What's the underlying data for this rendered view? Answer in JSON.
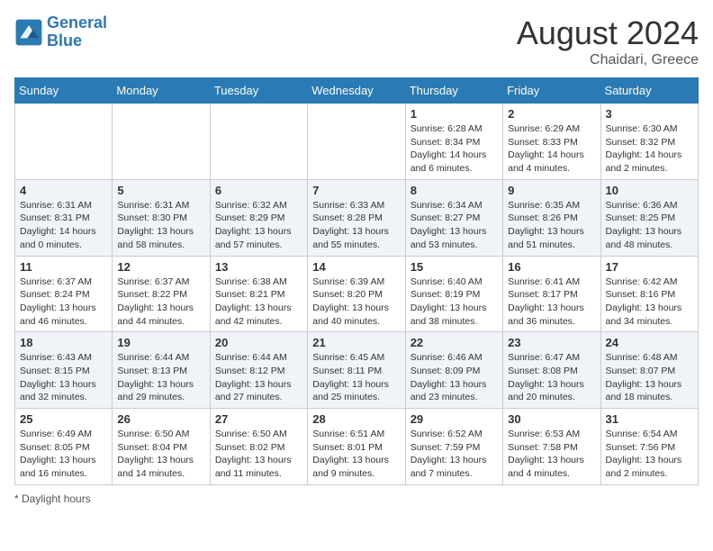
{
  "header": {
    "logo_general": "General",
    "logo_blue": "Blue",
    "month_year": "August 2024",
    "location": "Chaidari, Greece"
  },
  "days_of_week": [
    "Sunday",
    "Monday",
    "Tuesday",
    "Wednesday",
    "Thursday",
    "Friday",
    "Saturday"
  ],
  "weeks": [
    [
      {
        "day": "",
        "info": ""
      },
      {
        "day": "",
        "info": ""
      },
      {
        "day": "",
        "info": ""
      },
      {
        "day": "",
        "info": ""
      },
      {
        "day": "1",
        "info": "Sunrise: 6:28 AM\nSunset: 8:34 PM\nDaylight: 14 hours and 6 minutes."
      },
      {
        "day": "2",
        "info": "Sunrise: 6:29 AM\nSunset: 8:33 PM\nDaylight: 14 hours and 4 minutes."
      },
      {
        "day": "3",
        "info": "Sunrise: 6:30 AM\nSunset: 8:32 PM\nDaylight: 14 hours and 2 minutes."
      }
    ],
    [
      {
        "day": "4",
        "info": "Sunrise: 6:31 AM\nSunset: 8:31 PM\nDaylight: 14 hours and 0 minutes."
      },
      {
        "day": "5",
        "info": "Sunrise: 6:31 AM\nSunset: 8:30 PM\nDaylight: 13 hours and 58 minutes."
      },
      {
        "day": "6",
        "info": "Sunrise: 6:32 AM\nSunset: 8:29 PM\nDaylight: 13 hours and 57 minutes."
      },
      {
        "day": "7",
        "info": "Sunrise: 6:33 AM\nSunset: 8:28 PM\nDaylight: 13 hours and 55 minutes."
      },
      {
        "day": "8",
        "info": "Sunrise: 6:34 AM\nSunset: 8:27 PM\nDaylight: 13 hours and 53 minutes."
      },
      {
        "day": "9",
        "info": "Sunrise: 6:35 AM\nSunset: 8:26 PM\nDaylight: 13 hours and 51 minutes."
      },
      {
        "day": "10",
        "info": "Sunrise: 6:36 AM\nSunset: 8:25 PM\nDaylight: 13 hours and 48 minutes."
      }
    ],
    [
      {
        "day": "11",
        "info": "Sunrise: 6:37 AM\nSunset: 8:24 PM\nDaylight: 13 hours and 46 minutes."
      },
      {
        "day": "12",
        "info": "Sunrise: 6:37 AM\nSunset: 8:22 PM\nDaylight: 13 hours and 44 minutes."
      },
      {
        "day": "13",
        "info": "Sunrise: 6:38 AM\nSunset: 8:21 PM\nDaylight: 13 hours and 42 minutes."
      },
      {
        "day": "14",
        "info": "Sunrise: 6:39 AM\nSunset: 8:20 PM\nDaylight: 13 hours and 40 minutes."
      },
      {
        "day": "15",
        "info": "Sunrise: 6:40 AM\nSunset: 8:19 PM\nDaylight: 13 hours and 38 minutes."
      },
      {
        "day": "16",
        "info": "Sunrise: 6:41 AM\nSunset: 8:17 PM\nDaylight: 13 hours and 36 minutes."
      },
      {
        "day": "17",
        "info": "Sunrise: 6:42 AM\nSunset: 8:16 PM\nDaylight: 13 hours and 34 minutes."
      }
    ],
    [
      {
        "day": "18",
        "info": "Sunrise: 6:43 AM\nSunset: 8:15 PM\nDaylight: 13 hours and 32 minutes."
      },
      {
        "day": "19",
        "info": "Sunrise: 6:44 AM\nSunset: 8:13 PM\nDaylight: 13 hours and 29 minutes."
      },
      {
        "day": "20",
        "info": "Sunrise: 6:44 AM\nSunset: 8:12 PM\nDaylight: 13 hours and 27 minutes."
      },
      {
        "day": "21",
        "info": "Sunrise: 6:45 AM\nSunset: 8:11 PM\nDaylight: 13 hours and 25 minutes."
      },
      {
        "day": "22",
        "info": "Sunrise: 6:46 AM\nSunset: 8:09 PM\nDaylight: 13 hours and 23 minutes."
      },
      {
        "day": "23",
        "info": "Sunrise: 6:47 AM\nSunset: 8:08 PM\nDaylight: 13 hours and 20 minutes."
      },
      {
        "day": "24",
        "info": "Sunrise: 6:48 AM\nSunset: 8:07 PM\nDaylight: 13 hours and 18 minutes."
      }
    ],
    [
      {
        "day": "25",
        "info": "Sunrise: 6:49 AM\nSunset: 8:05 PM\nDaylight: 13 hours and 16 minutes."
      },
      {
        "day": "26",
        "info": "Sunrise: 6:50 AM\nSunset: 8:04 PM\nDaylight: 13 hours and 14 minutes."
      },
      {
        "day": "27",
        "info": "Sunrise: 6:50 AM\nSunset: 8:02 PM\nDaylight: 13 hours and 11 minutes."
      },
      {
        "day": "28",
        "info": "Sunrise: 6:51 AM\nSunset: 8:01 PM\nDaylight: 13 hours and 9 minutes."
      },
      {
        "day": "29",
        "info": "Sunrise: 6:52 AM\nSunset: 7:59 PM\nDaylight: 13 hours and 7 minutes."
      },
      {
        "day": "30",
        "info": "Sunrise: 6:53 AM\nSunset: 7:58 PM\nDaylight: 13 hours and 4 minutes."
      },
      {
        "day": "31",
        "info": "Sunrise: 6:54 AM\nSunset: 7:56 PM\nDaylight: 13 hours and 2 minutes."
      }
    ]
  ],
  "footer": {
    "note": "Daylight hours"
  }
}
